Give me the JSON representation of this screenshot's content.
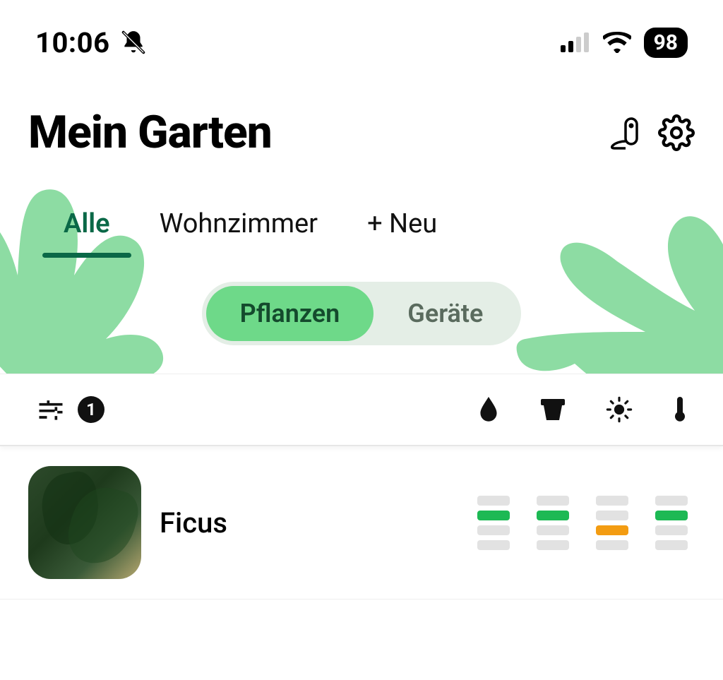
{
  "status": {
    "time": "10:06",
    "battery": "98"
  },
  "header": {
    "title": "Mein Garten"
  },
  "tabs": {
    "items": [
      {
        "label": "Alle",
        "active": true
      },
      {
        "label": "Wohnzimmer",
        "active": false
      },
      {
        "label": "+ Neu",
        "active": false
      }
    ]
  },
  "segmented": {
    "plants": "Pflanzen",
    "devices": "Geräte",
    "active": "plants"
  },
  "filter": {
    "count": "1"
  },
  "plants": [
    {
      "name": "Ficus",
      "metrics": {
        "water": [
          "off",
          "green",
          "off",
          "off"
        ],
        "pot": [
          "off",
          "green",
          "off",
          "off"
        ],
        "light": [
          "off",
          "off",
          "orange",
          "off"
        ],
        "temperature": [
          "off",
          "green",
          "off",
          "off"
        ]
      }
    }
  ],
  "colors": {
    "accent": "#0a6847",
    "segmentActive": "#6ed989",
    "barGreen": "#1db954",
    "barOrange": "#f39c12"
  }
}
